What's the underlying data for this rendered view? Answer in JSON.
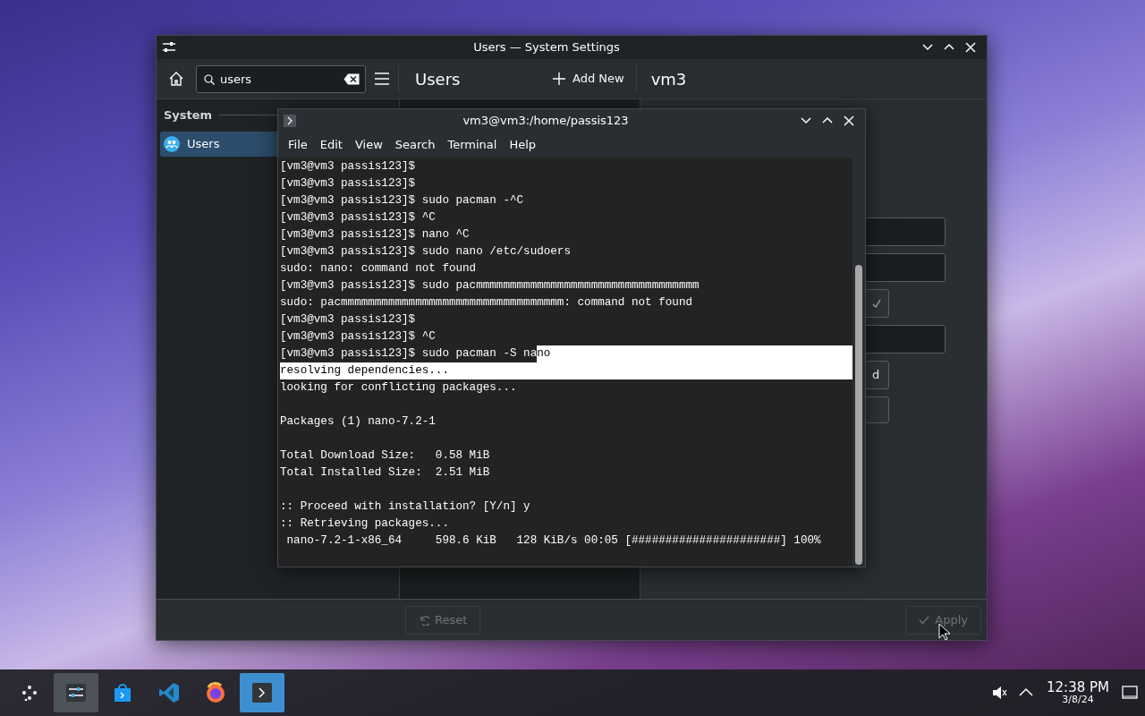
{
  "settings_window": {
    "title": "Users — System Settings",
    "search": {
      "value": "users"
    },
    "page_title": "Users",
    "add_button": "Add New",
    "user_title": "vm3",
    "sidebar": {
      "section": "System",
      "items": [
        {
          "label": "Users",
          "selected": true
        }
      ]
    },
    "form_controls": [
      {
        "kind": "field"
      },
      {
        "kind": "field"
      },
      {
        "kind": "icon_button"
      },
      {
        "kind": "field"
      },
      {
        "kind": "button",
        "label": "d"
      },
      {
        "kind": "button"
      }
    ],
    "footer": {
      "reset": {
        "label": "Reset",
        "disabled": true
      },
      "apply": {
        "label": "Apply",
        "disabled": true
      }
    }
  },
  "terminal": {
    "title": "vm3@vm3:/home/passis123",
    "menu": [
      "File",
      "Edit",
      "View",
      "Search",
      "Terminal",
      "Help"
    ],
    "lines": [
      {
        "parts": [
          {
            "text": "[vm3@vm3 passis123]$",
            "selected": false
          }
        ]
      },
      {
        "parts": [
          {
            "text": "[vm3@vm3 passis123]$",
            "selected": false
          }
        ]
      },
      {
        "parts": [
          {
            "text": "[vm3@vm3 passis123]$ sudo pacman -^C",
            "selected": false
          }
        ]
      },
      {
        "parts": [
          {
            "text": "[vm3@vm3 passis123]$ ^C",
            "selected": false
          }
        ]
      },
      {
        "parts": [
          {
            "text": "[vm3@vm3 passis123]$ nano ^C",
            "selected": false
          }
        ]
      },
      {
        "parts": [
          {
            "text": "[vm3@vm3 passis123]$ sudo nano /etc/sudoers",
            "selected": false
          }
        ]
      },
      {
        "parts": [
          {
            "text": "sudo: nano: command not found",
            "selected": false
          }
        ]
      },
      {
        "parts": [
          {
            "text": "[vm3@vm3 passis123]$ sudo pacmmmmmmmmmmmmmmmmmmmmmmmmmmmmmmmmm",
            "selected": false
          }
        ]
      },
      {
        "parts": [
          {
            "text": "sudo: pacmmmmmmmmmmmmmmmmmmmmmmmmmmmmmmmmm: command not found",
            "selected": false
          }
        ]
      },
      {
        "parts": [
          {
            "text": "[vm3@vm3 passis123]$",
            "selected": false
          }
        ]
      },
      {
        "parts": [
          {
            "text": "[vm3@vm3 passis123]$ ^C",
            "selected": false
          }
        ]
      },
      {
        "parts": [
          {
            "text": "[vm3@vm3 passis123]$ sudo pacman -S na",
            "selected": false
          },
          {
            "text": "no",
            "selected": true
          }
        ]
      },
      {
        "parts": [
          {
            "text": "resolving dependencies...",
            "selected": true
          }
        ]
      },
      {
        "parts": [
          {
            "text": "looking for conflicting packages...",
            "selected": false
          }
        ]
      },
      {
        "after_blank": true,
        "parts": [
          {
            "text": "Packages (1) nano-7.2-1",
            "selected": false
          }
        ]
      },
      {
        "after_blank": true,
        "parts": [
          {
            "text": "Total Download Size:   0.58 MiB",
            "selected": false
          }
        ]
      },
      {
        "parts": [
          {
            "text": "Total Installed Size:  2.51 MiB",
            "selected": false
          }
        ]
      },
      {
        "after_blank": true,
        "parts": [
          {
            "text": ":: Proceed with installation? [Y/n] y",
            "selected": false
          }
        ]
      },
      {
        "parts": [
          {
            "text": ":: Retrieving packages...",
            "selected": false
          }
        ]
      },
      {
        "parts": [
          {
            "text": " nano-7.2-1-x86_64     598.6 KiB   128 KiB/s 00:05 [######################] 100%",
            "selected": false
          }
        ]
      }
    ]
  },
  "taskbar": {
    "tasks": [
      {
        "kind": "launcher",
        "open": false,
        "focused": false
      },
      {
        "kind": "settings",
        "open": true,
        "focused": false
      },
      {
        "kind": "store",
        "open": false,
        "focused": false
      },
      {
        "kind": "code_editor",
        "open": false,
        "focused": false
      },
      {
        "kind": "browser",
        "open": false,
        "focused": false
      },
      {
        "kind": "terminal",
        "open": true,
        "focused": true
      }
    ],
    "clock": {
      "time": "12:38 PM",
      "date": "3/8/24"
    }
  }
}
